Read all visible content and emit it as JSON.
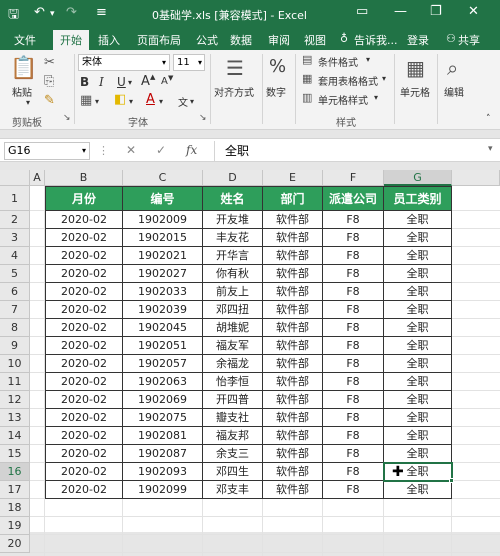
{
  "titlebar": {
    "title": "0基础学.xls  [兼容模式] - Excel",
    "save_icon": "save-icon",
    "undo_icon": "undo-icon",
    "redo_icon": "redo-icon",
    "customize_icon": "customize-icon",
    "ribbon_display_icon": "ribbon-display-icon",
    "minimize": "—",
    "restore": "❐",
    "close": "✕"
  },
  "tabs": {
    "file": "文件",
    "home": "开始",
    "insert": "插入",
    "page_layout": "页面布局",
    "formulas": "公式",
    "data": "数据",
    "review": "审阅",
    "view": "视图",
    "tell_me": "告诉我...",
    "login": "登录",
    "share": "共享"
  },
  "ribbon": {
    "paste": "粘贴",
    "clipboard_label": "剪贴板",
    "font_name": "宋体",
    "font_size": "11",
    "font_label": "字体",
    "bold": "B",
    "italic": "I",
    "underline": "U",
    "grow_font": "A",
    "shrink_font": "A",
    "font_color_letter": "A",
    "wen": "文",
    "alignment": "对齐方式",
    "number": "数字",
    "percent": "%",
    "conditional_format": "条件格式",
    "table_format": "套用表格格式",
    "cell_style": "单元格样式",
    "styles_label": "样式",
    "cells": "单元格",
    "editing": "编辑"
  },
  "formula_bar": {
    "name_box": "G16",
    "fx": "fx",
    "cancel": "✕",
    "enter": "✓",
    "value": "全职"
  },
  "sheet": {
    "columns": [
      "A",
      "B",
      "C",
      "D",
      "E",
      "F",
      "G"
    ],
    "selected_column": "G",
    "selected_row": "16",
    "row_numbers": [
      "1",
      "2",
      "3",
      "4",
      "5",
      "6",
      "7",
      "8",
      "9",
      "10",
      "11",
      "12",
      "13",
      "14",
      "15",
      "16",
      "17",
      "18",
      "19",
      "20"
    ],
    "headers": [
      "月份",
      "编号",
      "姓名",
      "部门",
      "派遣公司",
      "员工类别"
    ],
    "rows": [
      [
        "2020-02",
        "1902009",
        "开友堆",
        "软件部",
        "F8",
        "全职"
      ],
      [
        "2020-02",
        "1902015",
        "丰友花",
        "软件部",
        "F8",
        "全职"
      ],
      [
        "2020-02",
        "1902021",
        "开华言",
        "软件部",
        "F8",
        "全职"
      ],
      [
        "2020-02",
        "1902027",
        "你有秋",
        "软件部",
        "F8",
        "全职"
      ],
      [
        "2020-02",
        "1902033",
        "前友上",
        "软件部",
        "F8",
        "全职"
      ],
      [
        "2020-02",
        "1902039",
        "邓四扭",
        "软件部",
        "F8",
        "全职"
      ],
      [
        "2020-02",
        "1902045",
        "胡堆妮",
        "软件部",
        "F8",
        "全职"
      ],
      [
        "2020-02",
        "1902051",
        "福友军",
        "软件部",
        "F8",
        "全职"
      ],
      [
        "2020-02",
        "1902057",
        "余福龙",
        "软件部",
        "F8",
        "全职"
      ],
      [
        "2020-02",
        "1902063",
        "怡李恒",
        "软件部",
        "F8",
        "全职"
      ],
      [
        "2020-02",
        "1902069",
        "开四普",
        "软件部",
        "F8",
        "全职"
      ],
      [
        "2020-02",
        "1902075",
        "瓣支社",
        "软件部",
        "F8",
        "全职"
      ],
      [
        "2020-02",
        "1902081",
        "福友邦",
        "软件部",
        "F8",
        "全职"
      ],
      [
        "2020-02",
        "1902087",
        "余支三",
        "软件部",
        "F8",
        "全职"
      ],
      [
        "2020-02",
        "1902093",
        "邓四生",
        "软件部",
        "F8",
        "全职"
      ],
      [
        "2020-02",
        "1902099",
        "邓支丰",
        "软件部",
        "F8",
        "全职"
      ]
    ]
  },
  "colors": {
    "excel_green": "#217346",
    "header_fill": "#2e9e5b"
  }
}
